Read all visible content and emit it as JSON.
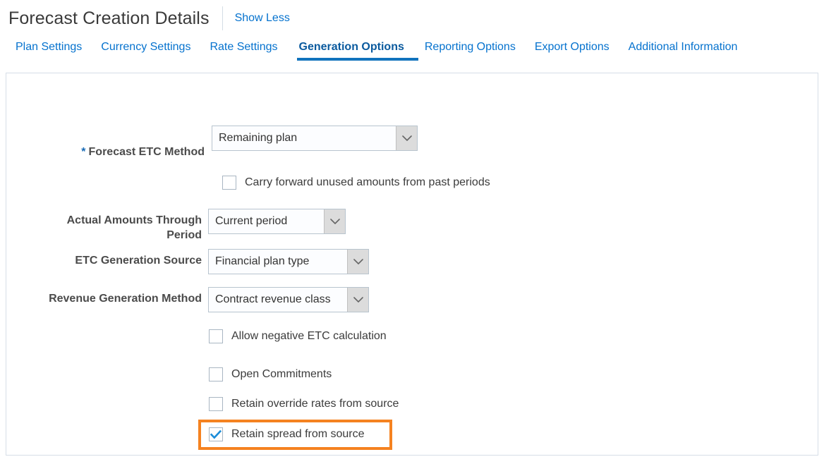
{
  "header": {
    "title": "Forecast Creation Details",
    "show_less_label": "Show Less",
    "divider": "vertical-divider"
  },
  "tabs": [
    {
      "label": "Plan Settings",
      "active": false
    },
    {
      "label": "Currency Settings",
      "active": false
    },
    {
      "label": "Rate Settings",
      "active": false
    },
    {
      "label": "Generation Options",
      "active": true
    },
    {
      "label": "Reporting Options",
      "active": false
    },
    {
      "label": "Export Options",
      "active": false
    },
    {
      "label": "Additional Information",
      "active": false
    }
  ],
  "form": {
    "fields": [
      {
        "label": "Forecast ETC Method",
        "required": true,
        "required_marker": "*",
        "value": "Remaining plan",
        "control": "dropdown"
      },
      {
        "label": "Actual Amounts Through\nPeriod",
        "required": false,
        "value": "Current period",
        "control": "dropdown"
      },
      {
        "label": "ETC Generation Source",
        "required": false,
        "value": "Financial plan type",
        "control": "dropdown"
      },
      {
        "label": "Revenue Generation Method",
        "required": false,
        "value": "Contract revenue class",
        "control": "dropdown"
      }
    ],
    "checkboxes": [
      {
        "label": "Carry forward unused amounts from past periods",
        "checked": false
      },
      {
        "label": "Allow negative ETC calculation",
        "checked": false
      },
      {
        "label": "Open Commitments",
        "checked": false
      },
      {
        "label": "Retain override rates from source",
        "checked": false
      },
      {
        "label": "Retain spread from source",
        "checked": true,
        "highlighted": true
      }
    ]
  },
  "colors": {
    "link": "#0572ce",
    "active_tab": "#0a5a9e",
    "tab_underline": "#1173bd",
    "required_star": "#186ab5",
    "highlight": "#f58220",
    "checkmark": "#1a8cd8",
    "panel_border": "#d6dee7",
    "label_text": "#4b4b4b"
  }
}
